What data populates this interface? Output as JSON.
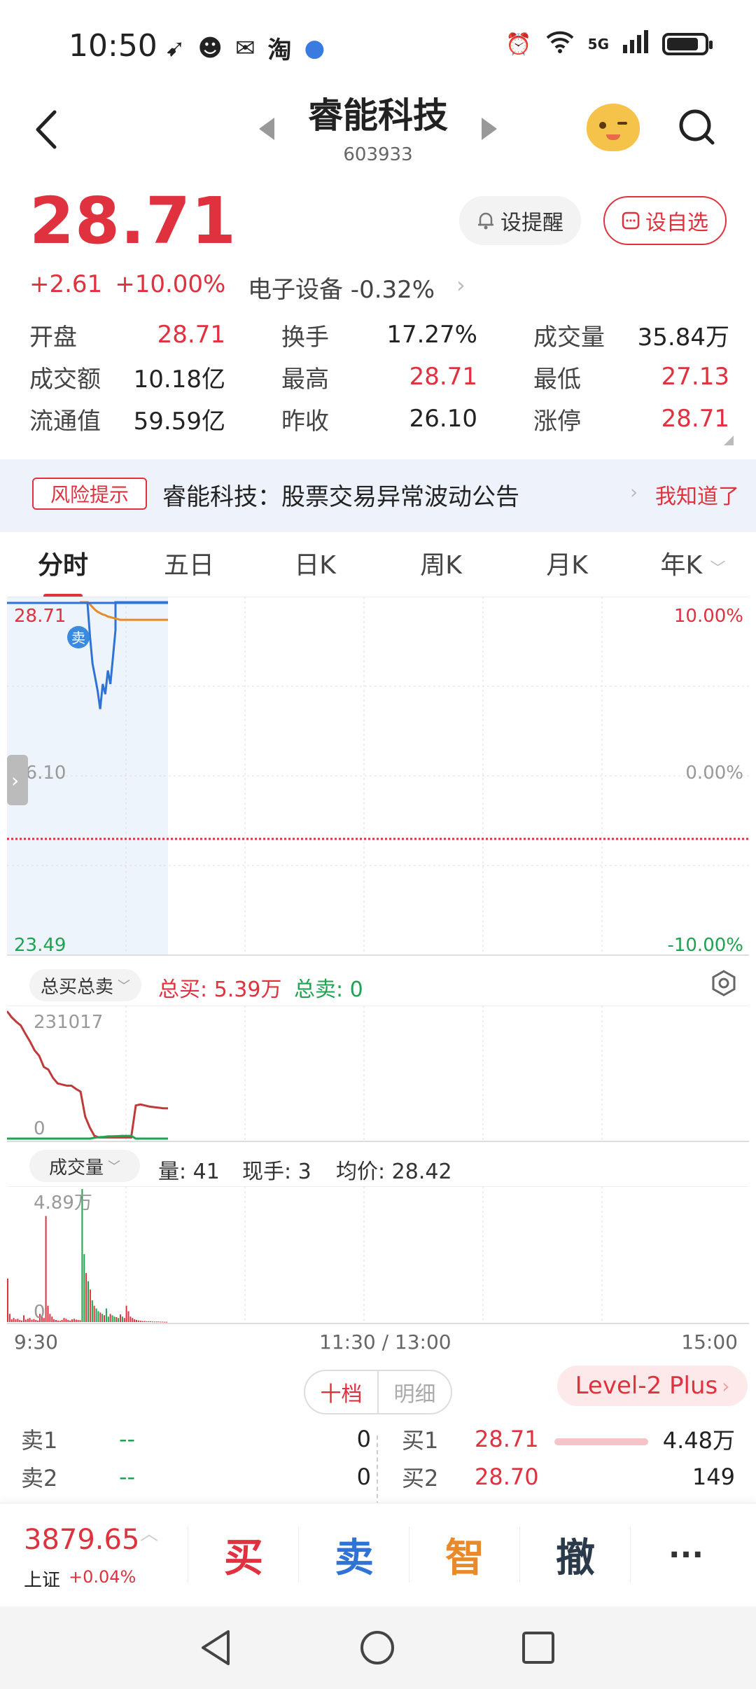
{
  "status_bar": {
    "time": "10:50",
    "left_icons": [
      "app-arrow-icon",
      "app-face-icon",
      "wechat-icon",
      "taobao-icon",
      "planet-icon"
    ],
    "taobao_text": "淘",
    "network": "5G",
    "right_icons": [
      "alarm-icon",
      "wifi-icon",
      "signal-icon",
      "battery-icon"
    ],
    "battery_level": 0.8
  },
  "header": {
    "title": "睿能科技",
    "code": "603933"
  },
  "quote": {
    "price": "28.71",
    "change": "+2.61",
    "change_pct": "+10.00%",
    "sector": "电子设备 -0.32%",
    "remind_label": "设提醒",
    "watch_label": "设自选"
  },
  "stats": [
    [
      {
        "label": "开盘",
        "value": "28.71",
        "color": "red"
      },
      {
        "label": "换手",
        "value": "17.27%",
        "color": "dark"
      },
      {
        "label": "成交量",
        "value": "35.84万",
        "color": "dark"
      }
    ],
    [
      {
        "label": "成交额",
        "value": "10.18亿",
        "color": "dark"
      },
      {
        "label": "最高",
        "value": "28.71",
        "color": "red"
      },
      {
        "label": "最低",
        "value": "27.13",
        "color": "red"
      }
    ],
    [
      {
        "label": "流通值",
        "value": "59.59亿",
        "color": "dark"
      },
      {
        "label": "昨收",
        "value": "26.10",
        "color": "dark"
      },
      {
        "label": "涨停",
        "value": "28.71",
        "color": "red"
      }
    ]
  ],
  "risk": {
    "tag": "风险提示",
    "text": "睿能科技：股票交易异常波动公告",
    "ack": "我知道了"
  },
  "tabs": [
    "分时",
    "五日",
    "日K",
    "周K",
    "月K",
    "年K"
  ],
  "chart": {
    "price_top": "28.71",
    "price_mid": "26.10",
    "price_bottom": "23.49",
    "pct_top": "10.00%",
    "pct_mid": "0.00%",
    "pct_bottom": "-10.00%",
    "sell_marker": "卖",
    "buysell_selector": "总买总卖",
    "total_buy": "总买: 5.39万",
    "total_sell": "总卖: 0",
    "mid_top": "231017",
    "mid_zero": "0",
    "vol_selector": "成交量",
    "vol_amount": "量: 41",
    "vol_current": "现手: 3",
    "vol_avg": "均价: 28.42",
    "vol_top": "4.89万",
    "vol_zero": "0",
    "time_start": "9:30",
    "time_mid": "11:30 / 13:00",
    "time_end": "15:00"
  },
  "chart_data": {
    "type": "line",
    "x_labels": [
      "9:30",
      "11:30 / 13:00",
      "15:00"
    ],
    "ylim": [
      23.49,
      28.71
    ],
    "prev_close": 26.1,
    "series": [
      {
        "color": "#2f73d6",
        "values": [
          28.71,
          28.71,
          28.71,
          28.71,
          28.2,
          27.8,
          27.6,
          27.4,
          27.13,
          27.5,
          27.35,
          27.7,
          27.5,
          27.9,
          28.3,
          28.71,
          28.71,
          28.71,
          28.71,
          28.71,
          28.71,
          28.71,
          28.71,
          28.71,
          28.71,
          28.71,
          28.71,
          28.71,
          28.71,
          28.71,
          28.71,
          28.71,
          28.71,
          28.71,
          28.71,
          28.71
        ]
      },
      {
        "color": "#e88a2a",
        "values": [
          28.71,
          28.71,
          28.71,
          28.71,
          28.68,
          28.64,
          28.6,
          28.57,
          28.55,
          28.53,
          28.52,
          28.5,
          28.49,
          28.48,
          28.47,
          28.46,
          28.45,
          28.45,
          28.45,
          28.45,
          28.45,
          28.45,
          28.45,
          28.45,
          28.45,
          28.45,
          28.45,
          28.45,
          28.45,
          28.45,
          28.45,
          28.45,
          28.45,
          28.45,
          28.45,
          28.45
        ]
      }
    ],
    "buy_sell": {
      "ylim": [
        0,
        231017
      ],
      "total_buy": [
        231017,
        220000,
        212000,
        205000,
        190000,
        176000,
        160000,
        150000,
        130000,
        125000,
        110000,
        100000,
        98000,
        96000,
        96000,
        90000,
        85000,
        40000,
        20000,
        5000,
        2000,
        2000,
        2000,
        2000,
        2000,
        2000,
        2000,
        2000,
        60000,
        62000,
        60000,
        58000,
        57000,
        56000,
        55000,
        55000
      ],
      "total_sell": [
        0,
        0,
        0,
        0,
        0,
        0,
        0,
        0,
        0,
        0,
        0,
        0,
        0,
        0,
        0,
        0,
        0,
        0,
        0,
        1500,
        2500,
        3000,
        4000,
        4000,
        4500,
        5000,
        5000,
        5000,
        0,
        0,
        0,
        0,
        0,
        0,
        0,
        0
      ]
    },
    "volume": {
      "ylim": [
        0,
        48900
      ],
      "values": [
        16000,
        3000,
        1000,
        1500,
        1000,
        1200,
        800,
        600,
        2500,
        900,
        1200,
        1500,
        900,
        1100,
        800,
        600,
        3000,
        2000,
        1500,
        39000,
        6000,
        3000,
        2000,
        1000,
        800,
        600,
        500,
        800,
        1500,
        1200,
        800,
        600,
        1000,
        1200,
        900,
        800,
        700,
        48900,
        25000,
        18000,
        15000,
        12000,
        8000,
        6000,
        5000,
        4000,
        3500,
        3000,
        2500,
        5000,
        2000,
        3000,
        2500,
        2000,
        1800,
        1500,
        2800,
        2000,
        1500,
        6000,
        4000,
        2000,
        1500,
        1000,
        800,
        600,
        500,
        400,
        400,
        300,
        300,
        300,
        200,
        200,
        200,
        200,
        150,
        150,
        100,
        100
      ],
      "colors": [
        "r",
        "r",
        "r",
        "r",
        "r",
        "r",
        "r",
        "r",
        "r",
        "r",
        "r",
        "r",
        "r",
        "r",
        "r",
        "r",
        "r",
        "r",
        "r",
        "r",
        "r",
        "r",
        "r",
        "r",
        "r",
        "r",
        "r",
        "r",
        "r",
        "r",
        "r",
        "r",
        "r",
        "r",
        "r",
        "r",
        "r",
        "g",
        "g",
        "r",
        "g",
        "r",
        "g",
        "r",
        "g",
        "g",
        "r",
        "g",
        "r",
        "g",
        "g",
        "r",
        "g",
        "g",
        "r",
        "g",
        "r",
        "g",
        "r",
        "r",
        "r",
        "r",
        "r",
        "r",
        "r",
        "r",
        "r",
        "r",
        "r",
        "r",
        "r",
        "r",
        "r",
        "r",
        "r",
        "r",
        "r",
        "r",
        "r",
        "r"
      ]
    }
  },
  "order_toggle": {
    "on": "十档",
    "off": "明细"
  },
  "level2": "Level-2 Plus",
  "order_book": {
    "sell": [
      {
        "label": "卖1",
        "price": "--",
        "vol": "0"
      },
      {
        "label": "卖2",
        "price": "--",
        "vol": "0"
      }
    ],
    "buy": [
      {
        "label": "买1",
        "price": "28.71",
        "vol": "4.48万",
        "bar": 1.0
      },
      {
        "label": "买2",
        "price": "28.70",
        "vol": "149",
        "bar": 0.003
      }
    ]
  },
  "index": {
    "value": "3879.65",
    "name": "上证",
    "pct": "+0.04%"
  },
  "actions": [
    {
      "label": "买",
      "color": "#e0323e"
    },
    {
      "label": "卖",
      "color": "#2f73d6"
    },
    {
      "label": "智",
      "color": "#e88a2a"
    },
    {
      "label": "撤",
      "color": "#2b3a4a"
    },
    {
      "label": "···",
      "color": "#333"
    }
  ],
  "colors": {
    "up": "#e0323e",
    "down": "#1fa350",
    "price_line": "#2f73d6",
    "avg_line": "#e88a2a"
  }
}
